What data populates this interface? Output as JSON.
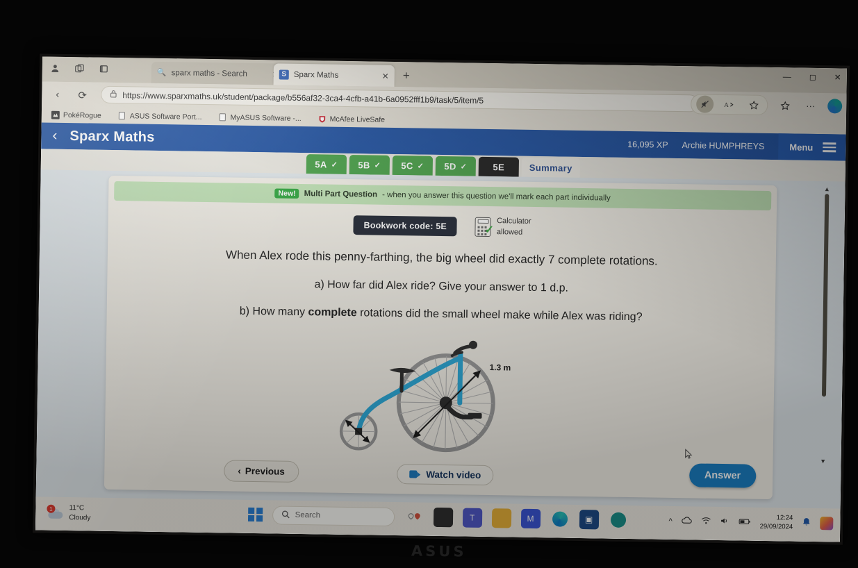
{
  "browser": {
    "tabs": [
      {
        "title": "sparx maths - Search",
        "icon": "search-icon",
        "active": false
      },
      {
        "title": "Sparx Maths",
        "icon": "sparx-favicon",
        "active": true
      }
    ],
    "new_tab_label": "+",
    "url": "https://www.sparxmaths.uk/student/package/b556af32-3ca4-4cfb-a41b-6a0952fff1b9/task/5/item/5",
    "window_controls": {
      "minimize": "—",
      "maximize": "◻",
      "close": "✕"
    },
    "toolbar_icons": [
      "tab-mute-icon",
      "read-aloud-icon",
      "favorites-star-icon",
      "collections-icon",
      "settings-ellipsis-icon",
      "copilot-icon"
    ],
    "tabstrip_icons": [
      "profile-icon",
      "tab-actions-icon",
      "tab-preview-icon"
    ],
    "nav_icons": {
      "back": "‹",
      "reload": "⟳",
      "lock": "🔒"
    },
    "bookmarks": [
      {
        "label": "PokéRogue",
        "icon": "pokerogue-favicon"
      },
      {
        "label": "ASUS Software Port...",
        "icon": "document-icon"
      },
      {
        "label": "MyASUS Software -...",
        "icon": "document-icon"
      },
      {
        "label": "McAfee LiveSafe",
        "icon": "mcafee-shield-icon"
      }
    ]
  },
  "sparx": {
    "title": "Sparx Maths",
    "back_label": "‹",
    "xp": "16,095 XP",
    "student": "Archie HUMPHREYS",
    "menu_label": "Menu",
    "tabs": [
      {
        "label": "5A",
        "state": "done",
        "tick": "✓"
      },
      {
        "label": "5B",
        "state": "done",
        "tick": "✓"
      },
      {
        "label": "5C",
        "state": "done",
        "tick": "✓"
      },
      {
        "label": "5D",
        "state": "done",
        "tick": "✓"
      },
      {
        "label": "5E",
        "state": "current",
        "tick": ""
      },
      {
        "label": "Summary",
        "state": "summary",
        "tick": ""
      }
    ],
    "banner": {
      "badge": "New!",
      "strong": "Multi Part Question",
      "rest": "- when you answer this question we'll mark each part individually"
    },
    "bookwork_code": "Bookwork code: 5E",
    "calculator": {
      "line1": "Calculator",
      "line2": "allowed",
      "check": "✓"
    },
    "question": {
      "intro": "When Alex rode this penny-farthing, the big wheel did exactly 7 complete rotations.",
      "part_a": "a) How far did Alex ride? Give your answer to 1 d.p.",
      "part_b_pre": "b) How many ",
      "part_b_bold": "complete",
      "part_b_post": " rotations did the small wheel make while Alex was riding?"
    },
    "figure": {
      "big_wheel_label": "1.3 m",
      "description": "penny-farthing-diagram"
    },
    "buttons": {
      "previous": "Previous",
      "previous_chevron": "‹",
      "watch_video": "Watch video",
      "answer": "Answer"
    },
    "scrollbar": {
      "up": "▲",
      "down": "▼"
    }
  },
  "taskbar": {
    "weather": {
      "temp": "11°C",
      "condition": "Cloudy",
      "badge": "1"
    },
    "search_placeholder": "Search",
    "apps": [
      "file-explorer-dark-icon",
      "microsoft-teams-icon",
      "file-explorer-icon",
      "mega-icon",
      "microsoft-edge-icon",
      "microsoft-store-icon",
      "spotify-icon"
    ],
    "tray": {
      "overflow": "^",
      "onedrive": "onedrive-icon",
      "wifi": "wifi-icon",
      "volume": "volume-icon",
      "battery": "battery-icon"
    },
    "clock": {
      "time": "12:24",
      "date": "29/09/2024"
    },
    "notification": "bell-icon"
  },
  "device": {
    "brand": "ASUS"
  },
  "colors": {
    "sparx_blue": "#1b4ea0",
    "tab_green": "#46a046",
    "tab_current": "#1b1b1b",
    "banner_green": "#bfe2b4",
    "answer_blue": "#1b7fc4",
    "frame_cyan": "#29a8d8"
  }
}
